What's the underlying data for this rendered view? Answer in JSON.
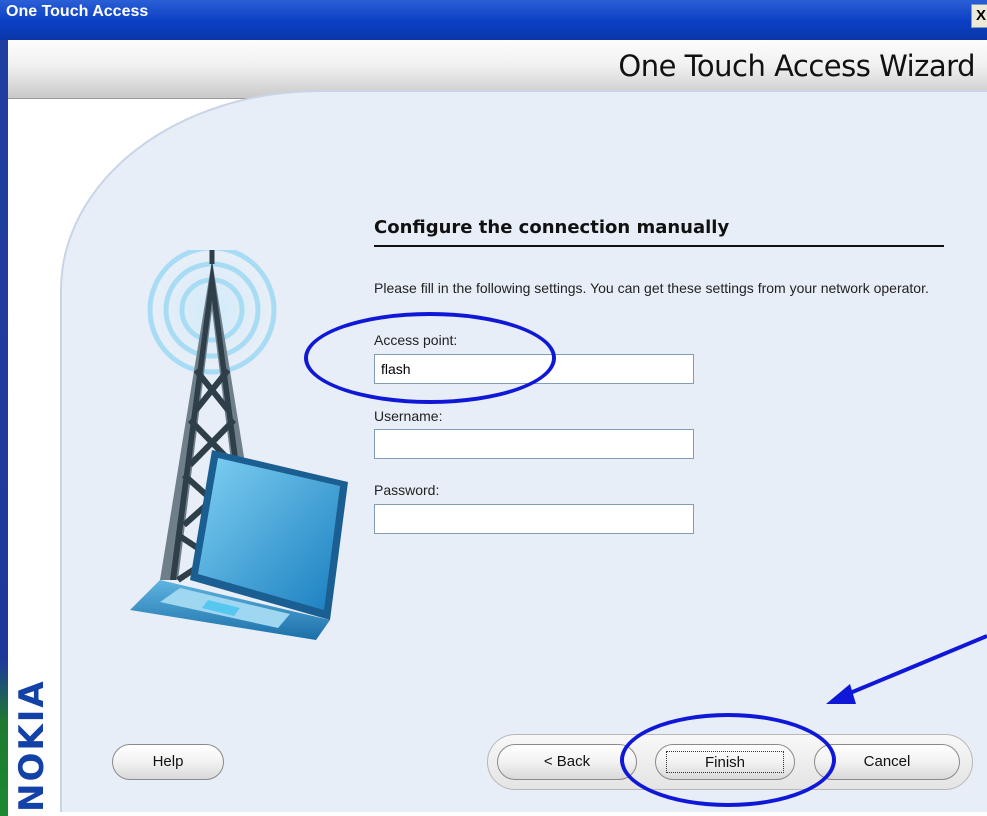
{
  "window": {
    "title": "One Touch Access",
    "close_glyph": "X"
  },
  "header": {
    "title": "One Touch Access Wizard"
  },
  "brand": {
    "logo_text": "NOKIA"
  },
  "section": {
    "title": "Configure the connection manually",
    "instructions": "Please fill in the following settings. You can get these settings from your network operator."
  },
  "fields": {
    "access_point": {
      "label": "Access point:",
      "value": "flash"
    },
    "username": {
      "label": "Username:",
      "value": ""
    },
    "password": {
      "label": "Password:",
      "value": ""
    }
  },
  "buttons": {
    "help": "Help",
    "back": "< Back",
    "finish": "Finish",
    "cancel": "Cancel"
  },
  "colors": {
    "titlebar": "#0b3fc4",
    "annotation": "#1018d8",
    "nokia_blue": "#1241a8"
  },
  "icons": {
    "illustration": "cell-tower-laptop-icon",
    "annotation_arrow": "arrow-icon"
  }
}
